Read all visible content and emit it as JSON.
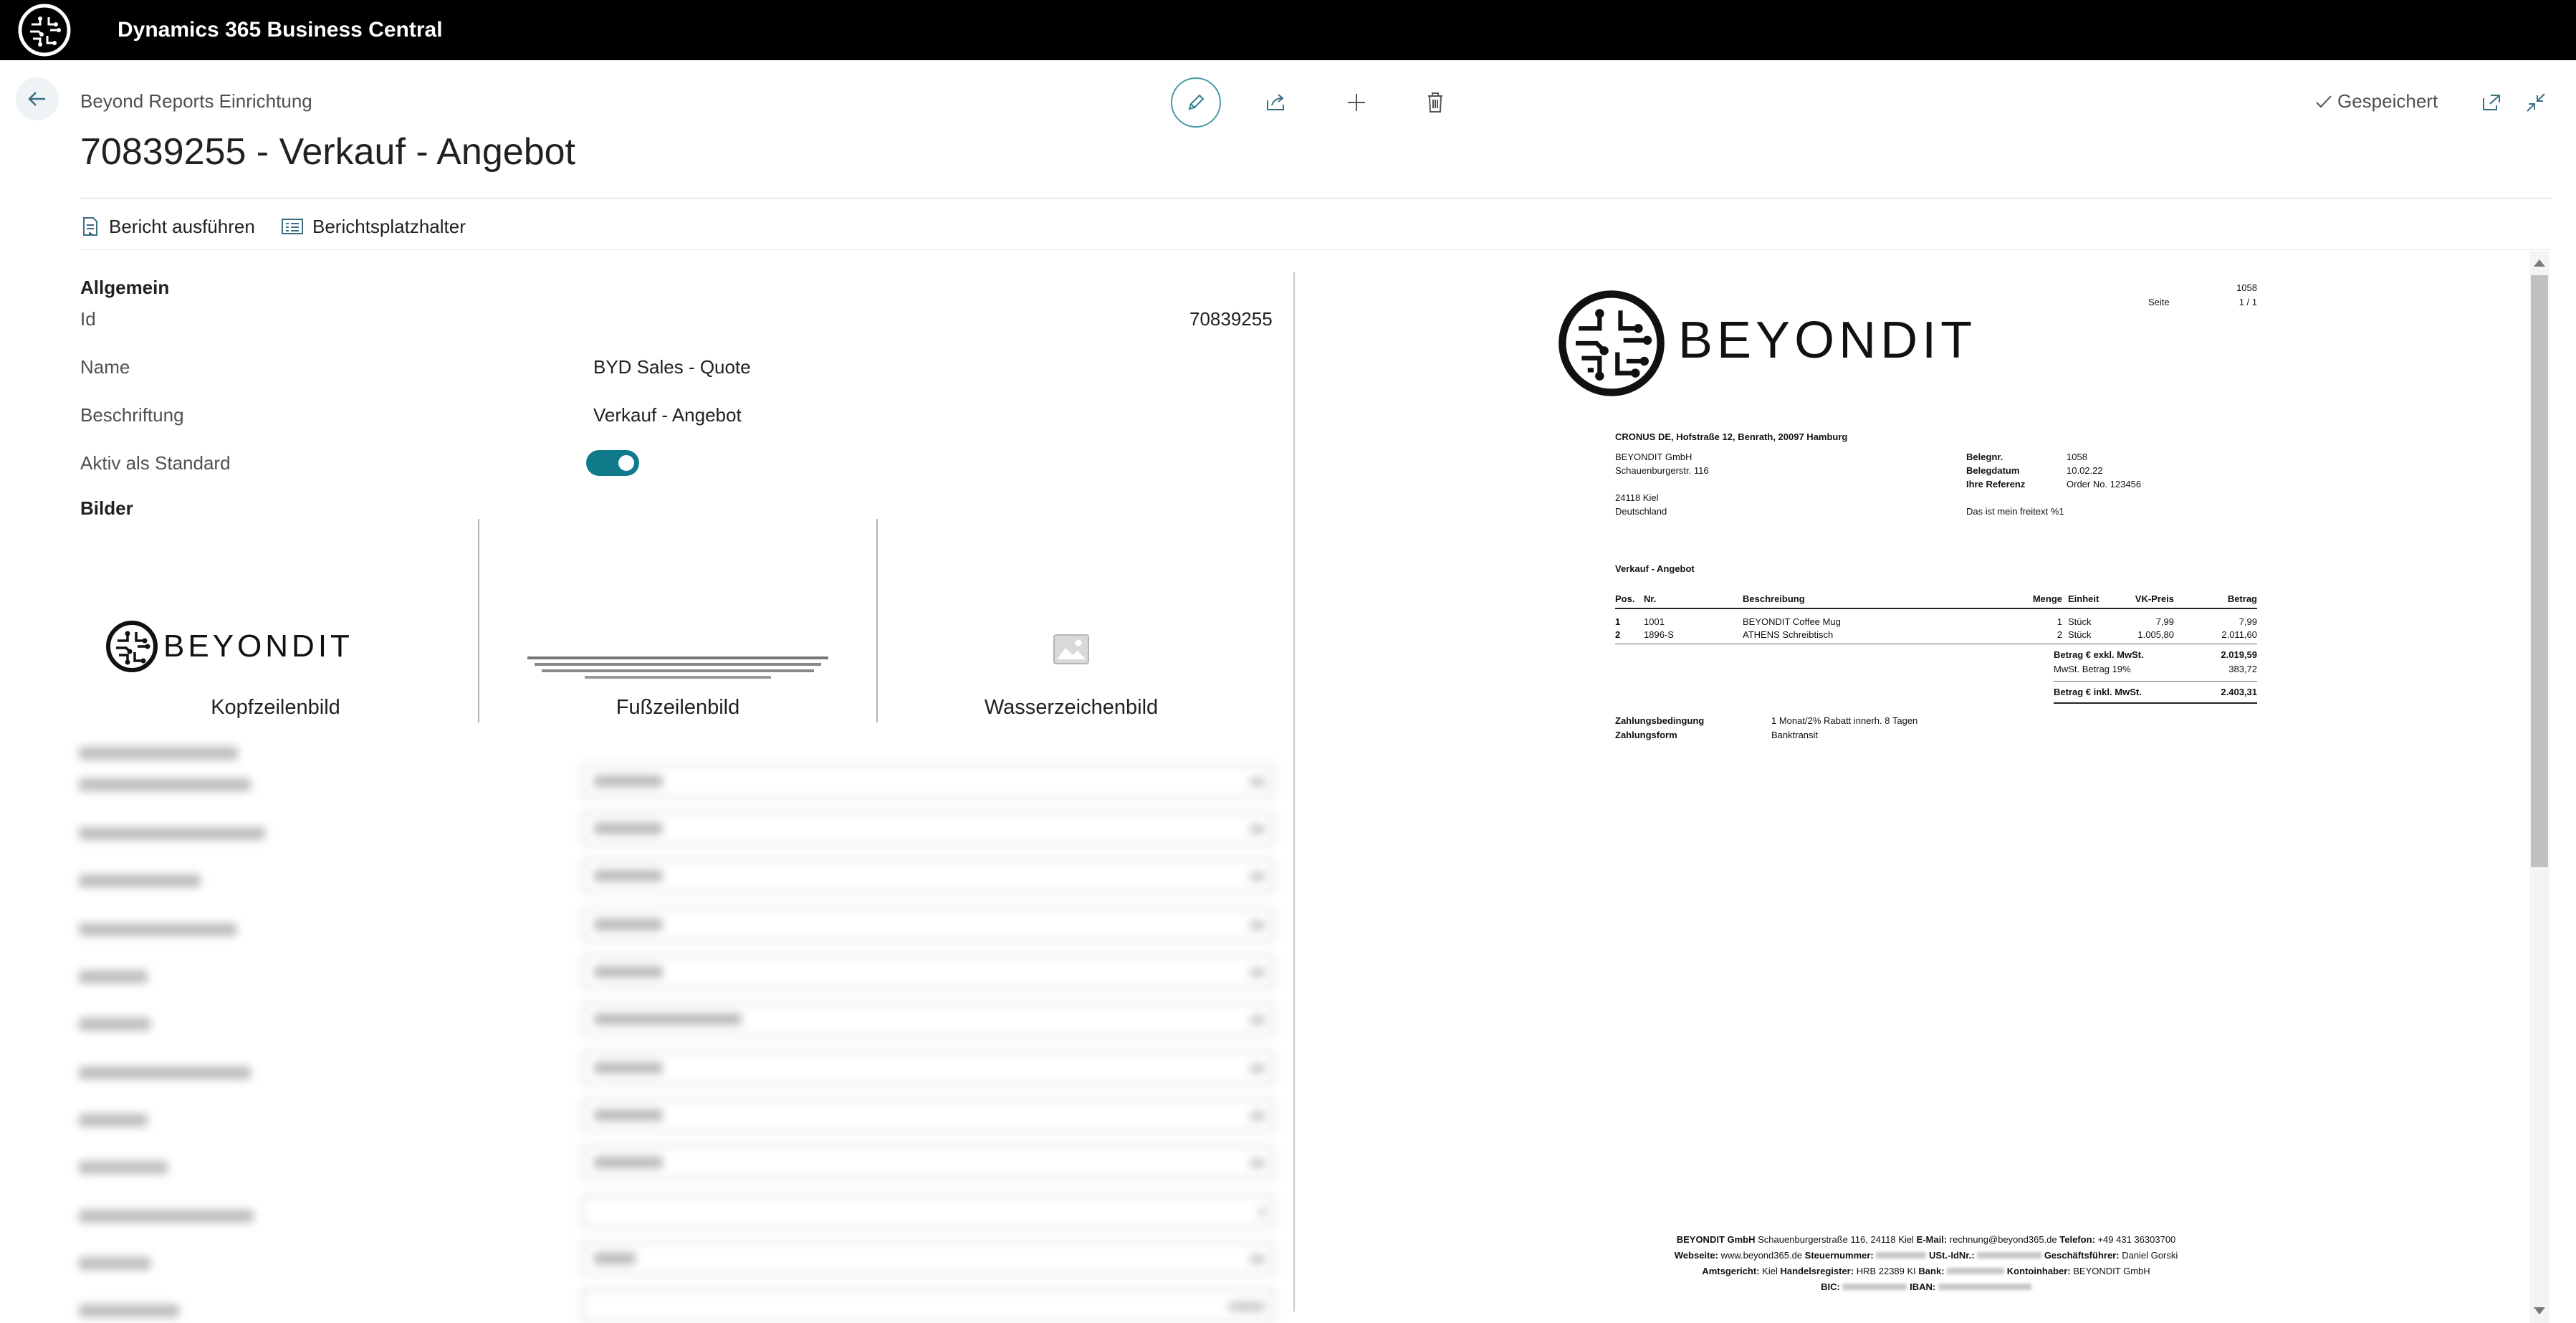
{
  "app": {
    "title": "Dynamics 365 Business Central"
  },
  "header": {
    "breadcrumb": "Beyond Reports Einrichtung",
    "title": "70839255 - Verkauf - Angebot",
    "saved_label": "Gespeichert"
  },
  "actions": {
    "run_report": "Bericht ausführen",
    "report_placeholder": "Berichtsplatzhalter"
  },
  "general": {
    "section": "Allgemein",
    "id_label": "Id",
    "id_value": "70839255",
    "name_label": "Name",
    "name_value": "BYD Sales - Quote",
    "caption_label": "Beschriftung",
    "caption_value": "Verkauf - Angebot",
    "active_label": "Aktiv als Standard",
    "active_value": true
  },
  "images": {
    "section": "Bilder",
    "header_caption": "Kopfzeilenbild",
    "footer_caption": "Fußzeilenbild",
    "watermark_caption": "Wasserzeichenbild",
    "logo_text": "BEYONDIT"
  },
  "report": {
    "logo_text": "BEYONDIT",
    "doc_no_top": "1058",
    "page_label": "Seite",
    "page_value": "1 / 1",
    "sender_line": "CRONUS DE, Hofstraße 12, Benrath, 20097 Hamburg",
    "address": [
      "BEYONDIT GmbH",
      "Schauenburgerstr. 116",
      "",
      "24118 Kiel",
      "Deutschland"
    ],
    "meta": [
      {
        "label": "Belegnr.",
        "value": "1058"
      },
      {
        "label": "Belegdatum",
        "value": "10.02.22"
      },
      {
        "label": "Ihre Referenz",
        "value": "Order No. 123456"
      }
    ],
    "free_text": "Das ist mein freitext %1",
    "doc_title": "Verkauf - Angebot",
    "columns": [
      "Pos.",
      "Nr.",
      "Beschreibung",
      "Menge",
      "Einheit",
      "VK-Preis",
      "Betrag"
    ],
    "lines": [
      {
        "pos": "1",
        "no": "1001",
        "desc": "BEYONDIT Coffee Mug",
        "qty": "1",
        "unit": "Stück",
        "price": "7,99",
        "amount": "7,99"
      },
      {
        "pos": "2",
        "no": "1896-S",
        "desc": "ATHENS Schreibtisch",
        "qty": "2",
        "unit": "Stück",
        "price": "1.005,80",
        "amount": "2.011,60"
      }
    ],
    "total_excl_label": "Betrag € exkl. MwSt.",
    "total_excl": "2.019,59",
    "vat_label": "MwSt. Betrag 19%",
    "vat": "383,72",
    "total_incl_label": "Betrag € inkl. MwSt.",
    "total_incl": "2.403,31",
    "payment_terms_label": "Zahlungsbedingung",
    "payment_terms": "1 Monat/2% Rabatt innerh. 8 Tagen",
    "payment_method_label": "Zahlungsform",
    "payment_method": "Banktransit",
    "footer": {
      "company": "BEYONDIT GmbH",
      "address": "Schauenburgerstraße 116, 24118 Kiel",
      "email_label": "E-Mail:",
      "email": "rechnung@beyond365.de",
      "phone_label": "Telefon:",
      "phone": "+49 431 36303700",
      "web_label": "Webseite:",
      "web": "www.beyond365.de",
      "tax_label": "Steuernummer:",
      "vat_label": "USt.-IdNr.:",
      "ceo_label": "Geschäftsführer:",
      "ceo": "Daniel Gorski",
      "court_label": "Amtsgericht:",
      "court": "Kiel",
      "register_label": "Handelsregister:",
      "register": "HRB 22389 KI",
      "bank_label": "Bank:",
      "holder_label": "Kontoinhaber:",
      "holder": "BEYONDIT GmbH",
      "bic_label": "BIC:",
      "iban_label": "IBAN:"
    }
  }
}
